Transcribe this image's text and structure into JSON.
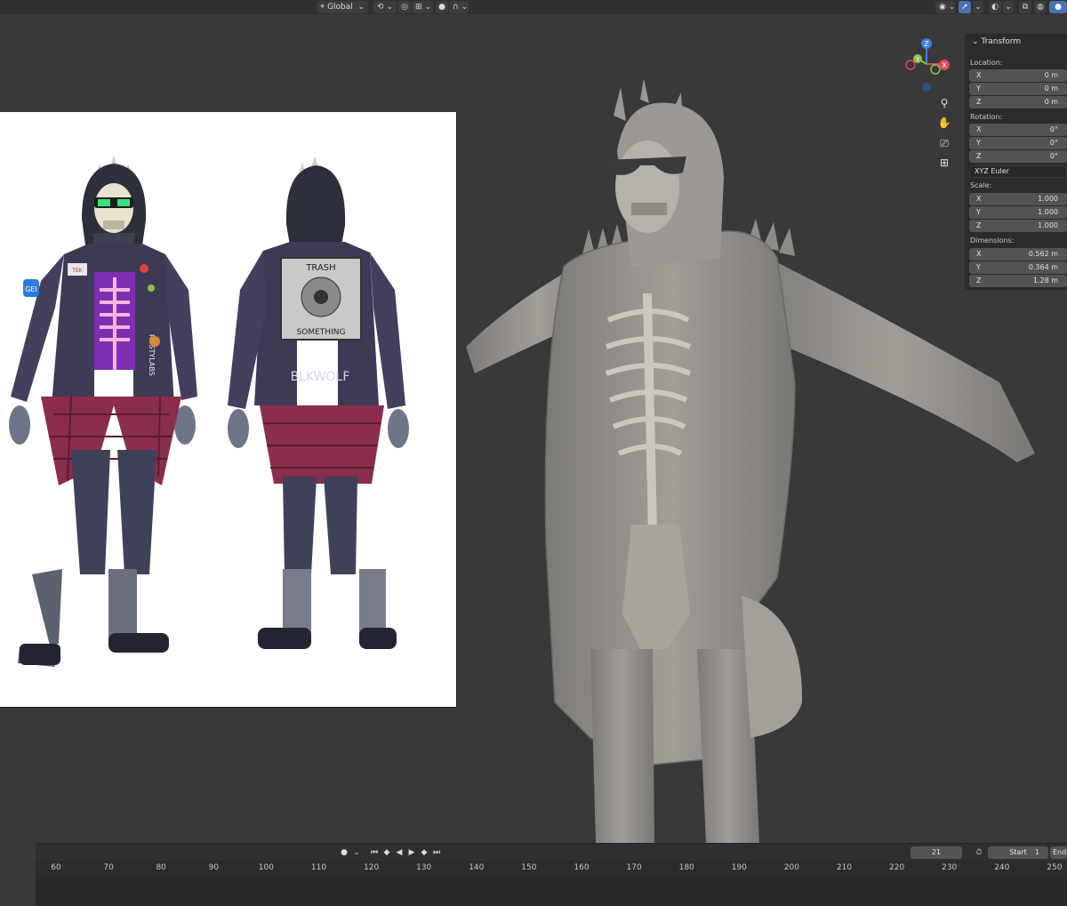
{
  "header": {
    "orientation": {
      "icon": "global-transform-icon",
      "label": "Global"
    },
    "buttons": [
      "pivot-icon",
      "snap-icon",
      "proportional-edit-icon",
      "falloff-icon"
    ],
    "right_icons": [
      "visibility-icon",
      "gizmo-toggle-icon",
      "overlay-icon",
      "xray-icon",
      "shading-solid-icon"
    ]
  },
  "gizmo": {
    "x": "X",
    "y": "Y",
    "z": "Z"
  },
  "npanel": {
    "title": "Transform",
    "location": {
      "label": "Location:",
      "x": "0 m",
      "y": "0 m",
      "z": "0 m"
    },
    "rotation": {
      "label": "Rotation:",
      "x": "0°",
      "y": "0°",
      "z": "0°"
    },
    "rotation_mode": "XYZ Euler",
    "scale": {
      "label": "Scale:",
      "x": "1.000",
      "y": "1.000",
      "z": "1.000"
    },
    "dimensions": {
      "label": "Dimensions:",
      "x": "0.562 m",
      "y": "0.364 m",
      "z": "1.28 m"
    },
    "axis_labels": {
      "x": "X",
      "y": "Y",
      "z": "Z"
    }
  },
  "timeline": {
    "current_frame": "21",
    "start_label": "Start",
    "start_value": "1",
    "end_label": "End",
    "ticks": [
      "60",
      "70",
      "80",
      "90",
      "100",
      "110",
      "120",
      "130",
      "140",
      "150",
      "160",
      "170",
      "180",
      "190",
      "200",
      "210",
      "220",
      "230",
      "240",
      "250"
    ]
  },
  "reference_sheet": {
    "back_patch_top": "TRASH",
    "back_patch_bottom": "SOMETHING",
    "back_graffiti": "BLKWOLF",
    "front_patch": "RUSTYLABS",
    "front_badge": "TEK",
    "sleeve_patch": "GEI"
  },
  "colors": {
    "accent": "#4772b3",
    "header_bg": "#303030",
    "viewport_bg": "#393939",
    "model_gray": "#8e8c88",
    "axis_x": "#e04a56",
    "axis_y": "#8bc34a",
    "axis_z": "#3f7fe0"
  }
}
